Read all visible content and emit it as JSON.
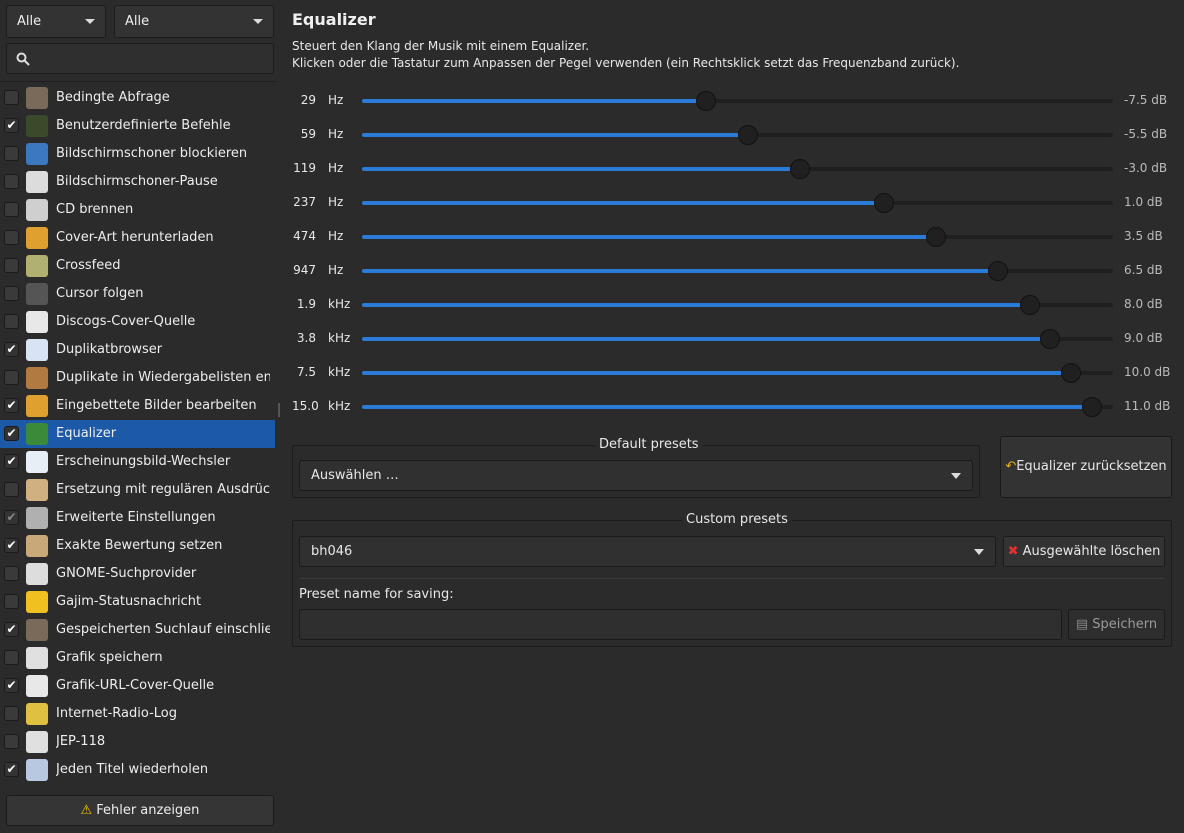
{
  "sidebar": {
    "filter_1": "Alle",
    "filter_2": "Alle",
    "search_placeholder": "",
    "errors_button": "Fehler anzeigen",
    "plugins": [
      {
        "label": "Bedingte Abfrage",
        "checked": false,
        "icon": "gamepad-icon",
        "color": "#7a6a5a"
      },
      {
        "label": "Benutzerdefinierte Befehle",
        "checked": true,
        "icon": "terminal-icon",
        "color": "#3c4a2c"
      },
      {
        "label": "Bildschirmschoner blockieren",
        "checked": false,
        "icon": "monitor-icon",
        "color": "#3b78c0"
      },
      {
        "label": "Bildschirmschoner-Pause",
        "checked": false,
        "icon": "pause-icon",
        "color": "#dcdcdc"
      },
      {
        "label": "CD brennen",
        "checked": false,
        "icon": "cd-icon",
        "color": "#cfcfcf"
      },
      {
        "label": "Cover-Art herunterladen",
        "checked": false,
        "icon": "image-download-icon",
        "color": "#e0a030"
      },
      {
        "label": "Crossfeed",
        "checked": false,
        "icon": "speaker-icon",
        "color": "#b0b070"
      },
      {
        "label": "Cursor folgen",
        "checked": false,
        "icon": "cursor-icon",
        "color": "#555555"
      },
      {
        "label": "Discogs-Cover-Quelle",
        "checked": false,
        "icon": "download-icon",
        "color": "#e8e8e8"
      },
      {
        "label": "Duplikatbrowser",
        "checked": true,
        "icon": "document-icon",
        "color": "#d8e4f4"
      },
      {
        "label": "Duplikate in Wiedergabelisten entf…",
        "checked": false,
        "icon": "broom-icon",
        "color": "#b07a40"
      },
      {
        "label": "Eingebettete Bilder bearbeiten",
        "checked": true,
        "icon": "image-edit-icon",
        "color": "#e0a030"
      },
      {
        "label": "Equalizer",
        "checked": true,
        "icon": "equalizer-icon",
        "color": "#3a8a3a"
      },
      {
        "label": "Erscheinungsbild-Wechsler",
        "checked": true,
        "icon": "chart-icon",
        "color": "#e8eef6"
      },
      {
        "label": "Ersetzung mit regulären Ausdrücken",
        "checked": false,
        "icon": "pencil-icon",
        "color": "#d0b080"
      },
      {
        "label": "Erweiterte Einstellungen",
        "checked": true,
        "disabled": true,
        "icon": "tools-icon",
        "color": "#b0b0b0"
      },
      {
        "label": "Exakte Bewertung setzen",
        "checked": true,
        "icon": "folder-star-icon",
        "color": "#c8a878"
      },
      {
        "label": "GNOME-Suchprovider",
        "checked": false,
        "icon": "gnome-icon",
        "color": "#dddddd"
      },
      {
        "label": "Gajim-Statusnachricht",
        "checked": false,
        "icon": "smiley-icon",
        "color": "#f0c020"
      },
      {
        "label": "Gespeicherten Suchlauf einschließ…",
        "checked": true,
        "icon": "gamepad-icon",
        "color": "#7a6a5a"
      },
      {
        "label": "Grafik speichern",
        "checked": false,
        "icon": "floppy-icon",
        "color": "#e0e0e0"
      },
      {
        "label": "Grafik-URL-Cover-Quelle",
        "checked": true,
        "icon": "download-icon",
        "color": "#e8e8e8"
      },
      {
        "label": "Internet-Radio-Log",
        "checked": false,
        "icon": "pen-icon",
        "color": "#e0c040"
      },
      {
        "label": "JEP-118",
        "checked": false,
        "icon": "floppy-icon",
        "color": "#e0e0e0"
      },
      {
        "label": "Jeden Titel wiederholen",
        "checked": true,
        "icon": "list-icon",
        "color": "#b8c8e0"
      }
    ],
    "selected_index": 12
  },
  "main": {
    "title": "Equalizer",
    "desc_line1": "Steuert den Klang der Musik mit einem Equalizer.",
    "desc_line2": "Klicken oder die Tastatur zum Anpassen der Pegel verwenden (ein Rechtsklick setzt das Frequenzband zurück).",
    "bands": [
      {
        "freq": "29",
        "unit": "Hz",
        "gain": -7.5,
        "label": "-7.5 dB"
      },
      {
        "freq": "59",
        "unit": "Hz",
        "gain": -5.5,
        "label": "-5.5 dB"
      },
      {
        "freq": "119",
        "unit": "Hz",
        "gain": -3.0,
        "label": "-3.0 dB"
      },
      {
        "freq": "237",
        "unit": "Hz",
        "gain": 1.0,
        "label": "1.0 dB"
      },
      {
        "freq": "474",
        "unit": "Hz",
        "gain": 3.5,
        "label": "3.5 dB"
      },
      {
        "freq": "947",
        "unit": "Hz",
        "gain": 6.5,
        "label": "6.5 dB"
      },
      {
        "freq": "1.9",
        "unit": "kHz",
        "gain": 8.0,
        "label": "8.0 dB"
      },
      {
        "freq": "3.8",
        "unit": "kHz",
        "gain": 9.0,
        "label": "9.0 dB"
      },
      {
        "freq": "7.5",
        "unit": "kHz",
        "gain": 10.0,
        "label": "10.0 dB"
      },
      {
        "freq": "15.0",
        "unit": "kHz",
        "gain": 11.0,
        "label": "11.0 dB"
      }
    ],
    "default_presets": {
      "title": "Default presets",
      "selected": "Auswählen …",
      "reset_button": "Equalizer zurücksetzen"
    },
    "custom_presets": {
      "title": "Custom presets",
      "selected": "bh046",
      "delete_button": "Ausgewählte löschen",
      "name_label": "Preset name for saving:",
      "name_value": "",
      "save_button": "Speichern"
    },
    "accent_color": "#2a7ad8"
  }
}
